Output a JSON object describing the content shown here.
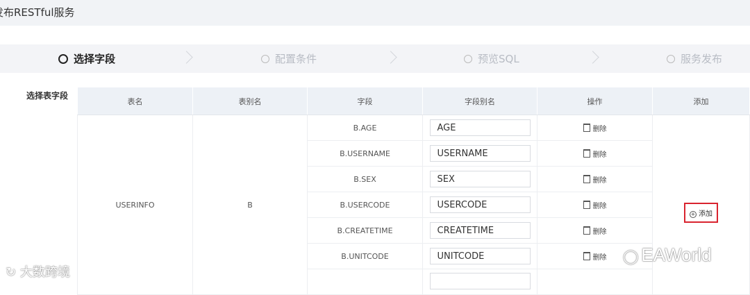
{
  "header": {
    "title": "发布RESTful服务"
  },
  "steps": [
    {
      "label": "选择字段",
      "active": true
    },
    {
      "label": "配置条件",
      "active": false
    },
    {
      "label": "预览SQL",
      "active": false
    },
    {
      "label": "服务发布",
      "active": false
    }
  ],
  "section_label": "选择表字段",
  "table": {
    "headers": [
      "表名",
      "表别名",
      "字段",
      "字段别名",
      "操作",
      "添加"
    ],
    "table_name": "USERINFO",
    "table_alias": "B",
    "rows": [
      {
        "field": "B.AGE",
        "alias": "AGE",
        "action": "删除"
      },
      {
        "field": "B.USERNAME",
        "alias": "USERNAME",
        "action": "删除"
      },
      {
        "field": "B.SEX",
        "alias": "SEX",
        "action": "删除"
      },
      {
        "field": "B.USERCODE",
        "alias": "USERCODE",
        "action": "删除"
      },
      {
        "field": "B.CREATETIME",
        "alias": "CREATETIME",
        "action": "删除"
      },
      {
        "field": "B.UNITCODE",
        "alias": "UNITCODE",
        "action": "删除"
      }
    ],
    "add_label": "添加"
  },
  "watermarks": {
    "left": "大数跨境",
    "right": "EAWorld"
  },
  "colors": {
    "highlight": "#d9232e",
    "header_bg": "#edf1f6",
    "steps_bg": "#f3f4f7"
  }
}
